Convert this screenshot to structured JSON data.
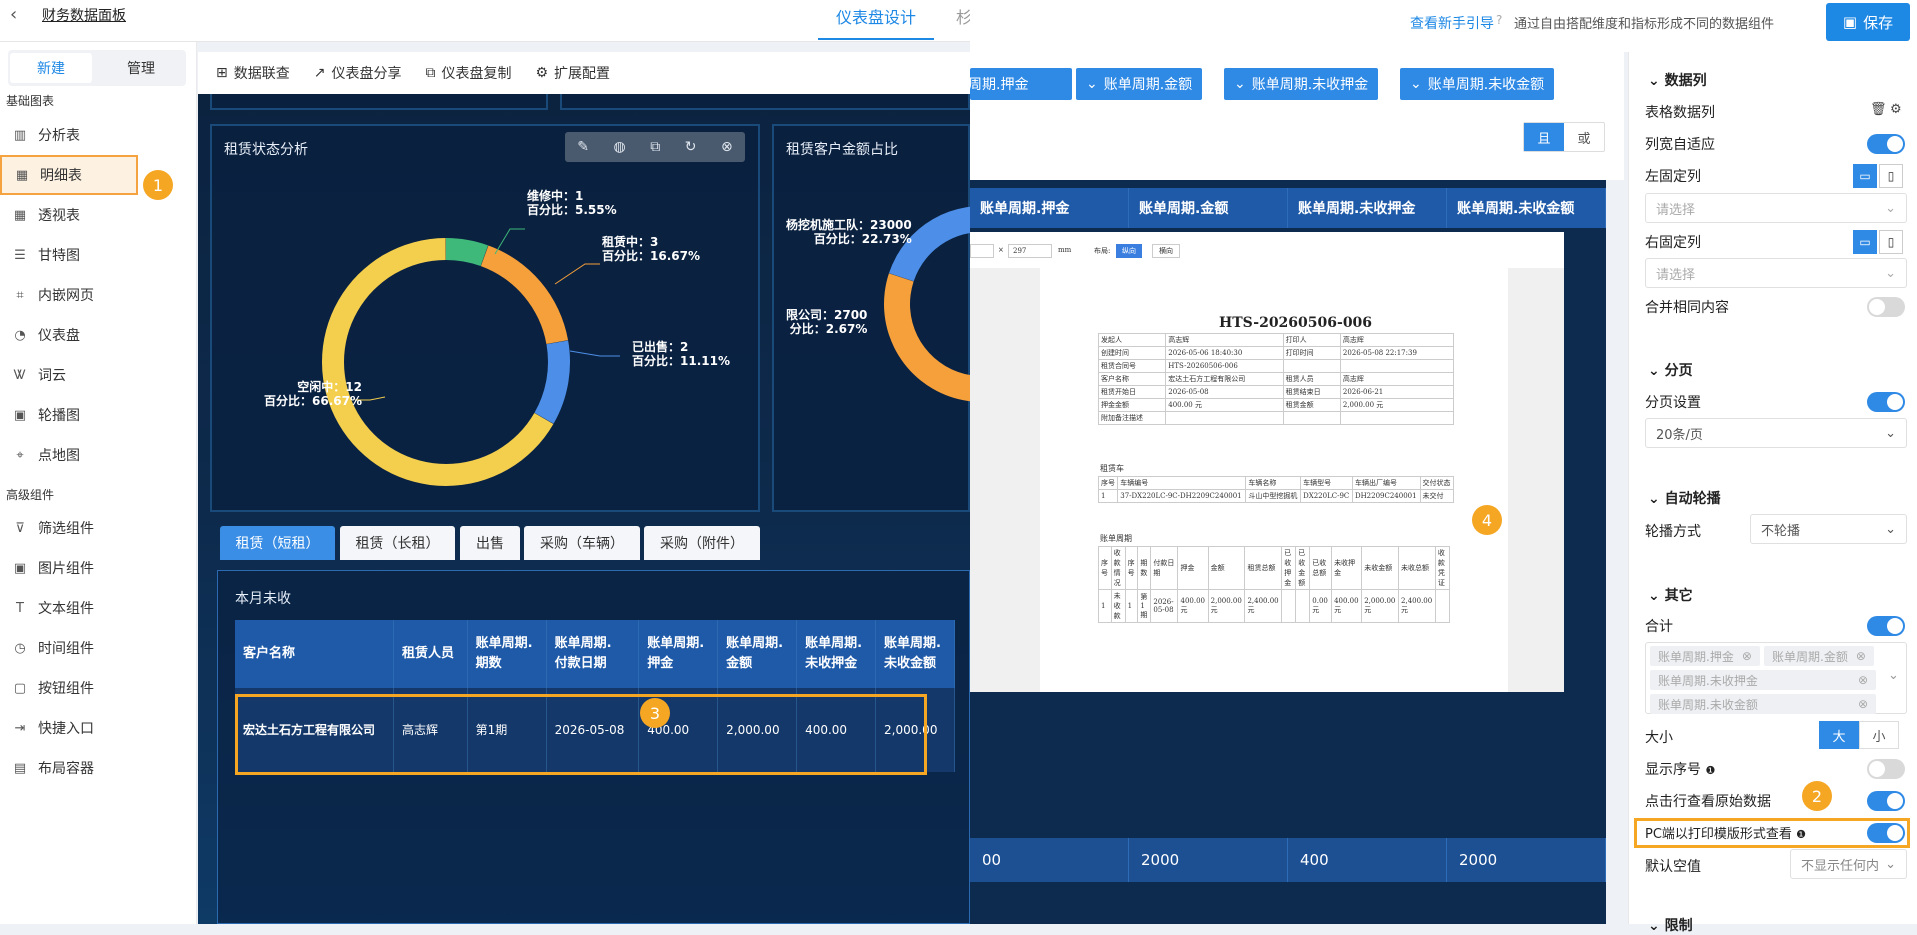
{
  "top": {
    "back": "‹",
    "app_title": "财务数据面板",
    "tab_design": "仪表盘设计",
    "tab_other": "杉"
  },
  "header_right": {
    "guide_link": "查看新手引导",
    "guide_text": "通过自由搭配维度和指标形成不同的数据组件",
    "save_label": "保存"
  },
  "sidebar": {
    "new_label": "新建",
    "manage_label": "管理",
    "section_basic": "基础图表",
    "section_advanced": "高级组件",
    "basic_items": [
      {
        "label": "分析表",
        "icon": "bar-chart-icon"
      },
      {
        "label": "明细表",
        "icon": "table-icon"
      },
      {
        "label": "透视表",
        "icon": "pivot-icon"
      },
      {
        "label": "甘特图",
        "icon": "gantt-icon"
      },
      {
        "label": "内嵌网页",
        "icon": "embed-icon"
      },
      {
        "label": "仪表盘",
        "icon": "gauge-icon"
      },
      {
        "label": "词云",
        "icon": "wordcloud-icon"
      },
      {
        "label": "轮播图",
        "icon": "carousel-icon"
      },
      {
        "label": "点地图",
        "icon": "map-pin-icon"
      }
    ],
    "advanced_items": [
      {
        "label": "筛选组件",
        "icon": "filter-icon"
      },
      {
        "label": "图片组件",
        "icon": "image-icon"
      },
      {
        "label": "文本组件",
        "icon": "text-icon"
      },
      {
        "label": "时间组件",
        "icon": "clock-icon"
      },
      {
        "label": "按钮组件",
        "icon": "button-icon"
      },
      {
        "label": "快捷入口",
        "icon": "shortcut-icon"
      },
      {
        "label": "布局容器",
        "icon": "layout-icon"
      }
    ]
  },
  "toolbar": [
    "数据联查",
    "仪表盘分享",
    "仪表盘复制",
    "扩展配置"
  ],
  "badges": [
    "1",
    "2",
    "3",
    "4"
  ],
  "chart_rent": {
    "title": "租赁状态分析",
    "labels": [
      {
        "name": "维修中：1",
        "pct": "百分比：5.55%"
      },
      {
        "name": "租赁中：3",
        "pct": "百分比：16.67%"
      },
      {
        "name": "已出售：2",
        "pct": "百分比：11.11%"
      },
      {
        "name": "空闲中：12",
        "pct": "百分比：66.67%"
      }
    ]
  },
  "chart_customer": {
    "title": "租赁客户金额占比",
    "labels": [
      {
        "name": "杨挖机施工队：23000",
        "pct": "百分比：22.73%"
      },
      {
        "name": "限公司：2700",
        "pct": "分比：2.67%"
      }
    ]
  },
  "chart_data": [
    {
      "type": "pie",
      "title": "租赁状态分析",
      "categories": [
        "维修中",
        "租赁中",
        "已出售",
        "空闲中"
      ],
      "values": [
        1,
        3,
        2,
        12
      ],
      "percentages": [
        5.55,
        16.67,
        11.11,
        66.67
      ],
      "colors": [
        "#3fb97a",
        "#f5a03a",
        "#4d8fe8",
        "#f4cf4e"
      ]
    },
    {
      "type": "pie",
      "title": "租赁客户金额占比",
      "categories": [
        "杨挖机施工队",
        "限公司"
      ],
      "values": [
        23000,
        2700
      ],
      "percentages": [
        22.73,
        2.67
      ]
    }
  ],
  "content_tabs": [
    "租赁（短租）",
    "租赁（长租）",
    "出售",
    "采购（车辆）",
    "采购（附件）"
  ],
  "detail_table": {
    "title": "本月未收",
    "headers": [
      "客户名称",
      "租赁人员",
      "账单周期.\n期数",
      "账单周期.\n付款日期",
      "账单周期.\n押金",
      "账单周期.\n金额",
      "账单周期.\n未收押金",
      "账单周期.\n未收金额"
    ],
    "row": [
      "宏达土石方工程有限公司",
      "高志辉",
      "第1期",
      "2026-05-08",
      "400.00",
      "2,000.00",
      "400.00",
      "2,000.00"
    ]
  },
  "filters": {
    "chips": [
      "账单周期.押金",
      "账单周期.金额",
      "账单周期.未收押金",
      "账单周期.未收金额"
    ],
    "and_label": "且",
    "or_label": "或"
  },
  "mid_table": {
    "headers": [
      "账单周期.押金",
      "账单周期.金额",
      "账单周期.未收押金",
      "账单周期.未收金额"
    ],
    "totals": [
      "00",
      "2000",
      "400",
      "2000"
    ]
  },
  "print_preview": {
    "unit": "mm",
    "size_val": "297",
    "layout_label": "布局:",
    "portrait": "纵向",
    "landscape": "横向",
    "doc_title": "HTS-20260506-006",
    "info": [
      [
        "发起人",
        "高志辉",
        "打印人",
        "高志辉"
      ],
      [
        "创建时间",
        "2026-05-06 18:40:30",
        "打印时间",
        "2026-05-08 22:17:39"
      ],
      [
        "租赁合同号",
        "HTS-20260506-006",
        "",
        ""
      ],
      [
        "客户名称",
        "宏达土石方工程有限公司",
        "租赁人员",
        "高志辉"
      ],
      [
        "租赁开始日",
        "2026-05-08",
        "租赁结束日",
        "2026-06-21"
      ],
      [
        "押金金额",
        "400.00 元",
        "租赁金额",
        "2,000.00 元"
      ],
      [
        "附加备注描述",
        "",
        "",
        ""
      ]
    ],
    "sec_vehicle": "租赁车",
    "vehicle_head": [
      "序号",
      "车辆编号",
      "车辆名称",
      "车辆型号",
      "车辆出厂编号",
      "交付状态"
    ],
    "vehicle_row": [
      "1",
      "37-DX220LC-9C-DH2209C240001",
      "斗山中型挖掘机",
      "DX220LC-9C",
      "DH2209C240001",
      "未交付"
    ],
    "sec_bill": "账单周期",
    "bill_head": [
      "序号",
      "收款情况",
      "序号",
      "期数",
      "付款日期",
      "押金",
      "金额",
      "租赁总额",
      "已收押金",
      "已收金额",
      "已收总额",
      "未收押金",
      "未收金额",
      "未收总额",
      "收款凭证"
    ],
    "bill_row": [
      "1",
      "未收款",
      "1",
      "第1期",
      "2026-05-08",
      "400.00元",
      "2,000.00元",
      "2,400.00元",
      "",
      "",
      "0.00元",
      "400.00元",
      "2,000.00元",
      "2,400.00元",
      ""
    ]
  },
  "right_panel": {
    "sec_datacol": "数据列",
    "table_col_label": "表格数据列",
    "col_autowidth": "列宽自适应",
    "left_fix": "左固定列",
    "right_fix": "右固定列",
    "placeholder": "请选择",
    "merge_same": "合并相同内容",
    "sec_paging": "分页",
    "paging_setting": "分页设置",
    "page_size": "20条/页",
    "sec_autoplay": "自动轮播",
    "carousel_mode": "轮播方式",
    "carousel_val": "不轮播",
    "sec_other": "其它",
    "total_label": "合计",
    "total_tags": [
      "账单周期.押金",
      "账单周期.金额",
      "账单周期.未收押金",
      "账单周期.未收金额"
    ],
    "size_label": "大小",
    "size_big": "大",
    "size_small": "小",
    "show_index": "显示序号",
    "click_raw": "点击行查看原始数据",
    "print_view": "PC端以打印模版形式查看",
    "default_empty": "默认空值",
    "default_empty_val": "不显示任何内",
    "sec_more": "限制"
  }
}
